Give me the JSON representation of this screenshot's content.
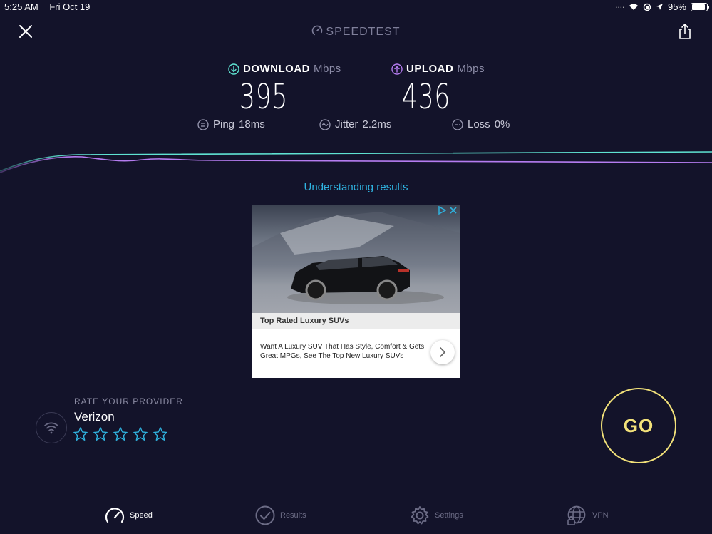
{
  "status_bar": {
    "time": "5:25 AM",
    "date": "Fri Oct 19",
    "battery": "95%"
  },
  "header": {
    "title": "SPEEDTEST",
    "close_icon": "close-icon",
    "share_icon": "share-icon"
  },
  "results": {
    "download": {
      "label": "DOWNLOAD",
      "unit": "Mbps",
      "value": "395",
      "color": "#5fe3d2"
    },
    "upload": {
      "label": "UPLOAD",
      "unit": "Mbps",
      "value": "436",
      "color": "#b57cf0"
    },
    "ping": {
      "label": "Ping",
      "value": "18ms"
    },
    "jitter": {
      "label": "Jitter",
      "value": "2.2ms"
    },
    "loss": {
      "label": "Loss",
      "value": "0%"
    }
  },
  "understanding_link": "Understanding results",
  "ad": {
    "headline": "Top Rated Luxury SUVs",
    "body": "Want A Luxury SUV That Has Style, Comfort & Gets Great MPGs, See The Top New Luxury SUVs"
  },
  "provider": {
    "rate_label": "RATE YOUR PROVIDER",
    "name": "Verizon",
    "star_count": 5,
    "rating": 0
  },
  "go_button": "GO",
  "tabs": [
    {
      "label": "Speed",
      "icon": "speedometer-icon",
      "active": true
    },
    {
      "label": "Results",
      "icon": "check-circle-icon",
      "active": false
    },
    {
      "label": "Settings",
      "icon": "gear-icon",
      "active": false
    },
    {
      "label": "VPN",
      "icon": "globe-lock-icon",
      "active": false
    }
  ],
  "colors": {
    "background": "#13132a",
    "accent_link": "#2fb3e0",
    "go": "#f3e27a"
  }
}
